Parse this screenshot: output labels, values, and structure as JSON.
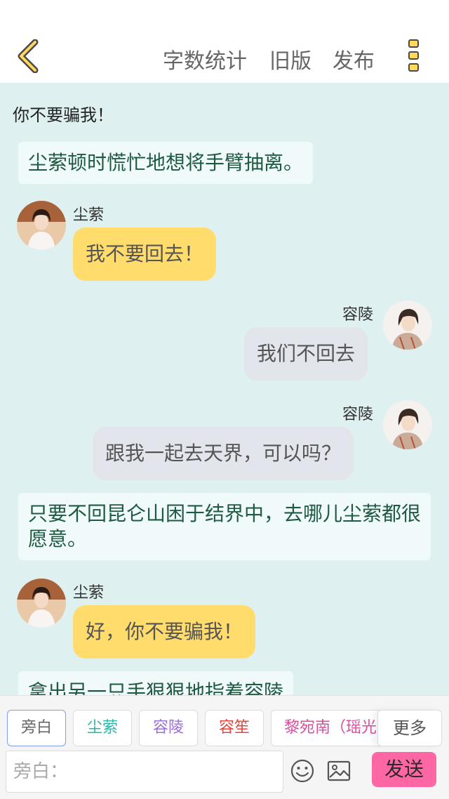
{
  "topbar": {
    "word_count": "字数统计",
    "old_version": "旧版",
    "publish": "发布"
  },
  "messages": {
    "m1": "你不要骗我！",
    "m2": "尘萦顿时慌忙地想将手臂抽离。",
    "m3_name": "尘萦",
    "m3_text": "我不要回去！",
    "m4_name": "容陵",
    "m4_text": "我们不回去",
    "m5_name": "容陵",
    "m5_text": "跟我一起去天界，可以吗？",
    "m6": "只要不回昆仑山困于结界中，去哪儿尘萦都很愿意。",
    "m7_name": "尘萦",
    "m7_text": "好，你不要骗我！",
    "m8": "拿出另一只手狠狠地指着容陵"
  },
  "composer": {
    "roles": [
      {
        "label": "旁白",
        "color": "#666666"
      },
      {
        "label": "尘萦",
        "color": "#2db5a8"
      },
      {
        "label": "容陵",
        "color": "#9c6fd6"
      },
      {
        "label": "容笙",
        "color": "#e2453c"
      },
      {
        "label": "黎宛南（瑶光",
        "color": "#d94fa0"
      }
    ],
    "more": "更多",
    "placeholder": "旁白：",
    "send": "发送"
  },
  "colors": {
    "chat_bg": "#def1f0",
    "bubble_yellow": "#ffdc6c",
    "bubble_gray": "#e2e5ec",
    "send_button": "#ff67a4",
    "narration_text": "#1d5a40"
  },
  "icons": [
    "back-chevron-icon",
    "more-menu-icon",
    "emoji-icon",
    "image-icon"
  ]
}
